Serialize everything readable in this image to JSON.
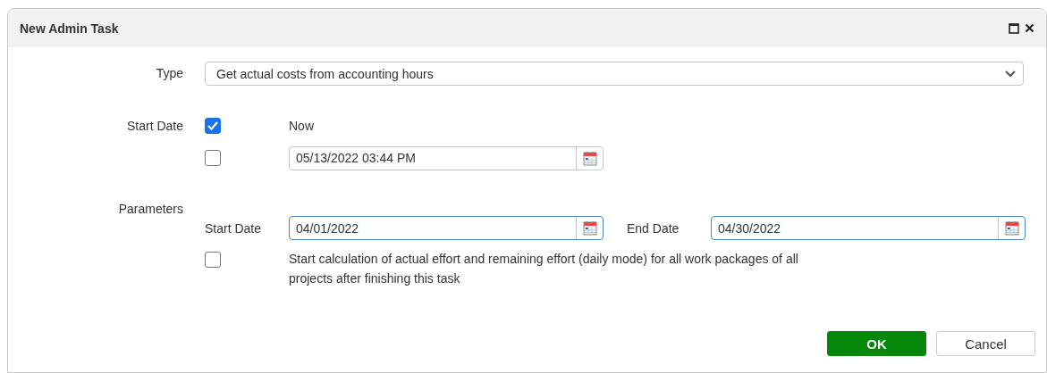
{
  "window": {
    "title": "New Admin Task"
  },
  "type": {
    "label": "Type",
    "value": "Get actual costs from accounting hours"
  },
  "start_date": {
    "label": "Start Date",
    "options": [
      {
        "kind": "text",
        "checked": true,
        "text": "Now"
      },
      {
        "kind": "date",
        "checked": false,
        "value": "05/13/2022 03:44 PM"
      }
    ]
  },
  "parameters": {
    "label": "Parameters",
    "start_label": "Start Date",
    "start_value": "04/01/2022",
    "end_label": "End Date",
    "end_value": "04/30/2022",
    "calc_checked": false,
    "calc_text": "Start calculation of actual effort and remaining effort (daily mode) for all work packages of all projects after finishing this task"
  },
  "buttons": [
    {
      "kind": "primary",
      "label": "OK"
    },
    {
      "kind": "secondary",
      "label": "Cancel"
    }
  ]
}
